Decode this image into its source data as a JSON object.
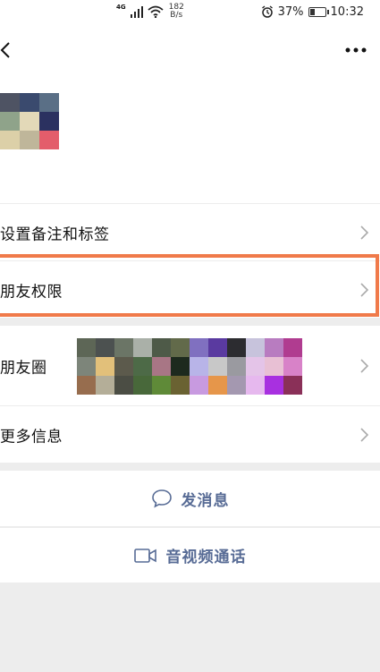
{
  "status_bar": {
    "network": "4G",
    "speed_value": "182",
    "speed_unit": "B/s",
    "battery": "37%",
    "battery_level": 0.37,
    "time": "10:32",
    "icons": [
      "signal-icon",
      "wifi-icon",
      "alarm-icon",
      "battery-icon"
    ]
  },
  "nav": {
    "back_icon": "back-arrow-icon",
    "more_icon": "more-dots-icon"
  },
  "menu": {
    "remark": "设置备注和标签",
    "permissions": "朋友权限",
    "moments": "朋友圈",
    "more_info": "更多信息"
  },
  "actions": {
    "message": "发消息",
    "call": "音视频通话"
  },
  "colors": {
    "link_blue": "#576b95",
    "highlight_orange": "#f07a4a",
    "background": "#ededed"
  }
}
